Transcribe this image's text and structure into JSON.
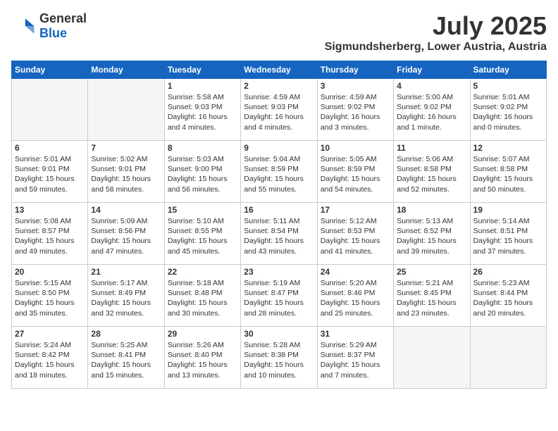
{
  "header": {
    "logo_general": "General",
    "logo_blue": "Blue",
    "month": "July 2025",
    "location": "Sigmundsherberg, Lower Austria, Austria"
  },
  "days_of_week": [
    "Sunday",
    "Monday",
    "Tuesday",
    "Wednesday",
    "Thursday",
    "Friday",
    "Saturday"
  ],
  "weeks": [
    [
      {
        "day": "",
        "empty": true
      },
      {
        "day": "",
        "empty": true
      },
      {
        "day": "1",
        "sunrise": "5:58 AM",
        "sunset": "9:03 PM",
        "daylight": "16 hours and 4 minutes."
      },
      {
        "day": "2",
        "sunrise": "4:59 AM",
        "sunset": "9:03 PM",
        "daylight": "16 hours and 4 minutes."
      },
      {
        "day": "3",
        "sunrise": "4:59 AM",
        "sunset": "9:02 PM",
        "daylight": "16 hours and 3 minutes."
      },
      {
        "day": "4",
        "sunrise": "5:00 AM",
        "sunset": "9:02 PM",
        "daylight": "16 hours and 1 minute."
      },
      {
        "day": "5",
        "sunrise": "5:01 AM",
        "sunset": "9:02 PM",
        "daylight": "16 hours and 0 minutes."
      }
    ],
    [
      {
        "day": "6",
        "sunrise": "5:01 AM",
        "sunset": "9:01 PM",
        "daylight": "15 hours and 59 minutes."
      },
      {
        "day": "7",
        "sunrise": "5:02 AM",
        "sunset": "9:01 PM",
        "daylight": "15 hours and 58 minutes."
      },
      {
        "day": "8",
        "sunrise": "5:03 AM",
        "sunset": "9:00 PM",
        "daylight": "15 hours and 56 minutes."
      },
      {
        "day": "9",
        "sunrise": "5:04 AM",
        "sunset": "8:59 PM",
        "daylight": "15 hours and 55 minutes."
      },
      {
        "day": "10",
        "sunrise": "5:05 AM",
        "sunset": "8:59 PM",
        "daylight": "15 hours and 54 minutes."
      },
      {
        "day": "11",
        "sunrise": "5:06 AM",
        "sunset": "8:58 PM",
        "daylight": "15 hours and 52 minutes."
      },
      {
        "day": "12",
        "sunrise": "5:07 AM",
        "sunset": "8:58 PM",
        "daylight": "15 hours and 50 minutes."
      }
    ],
    [
      {
        "day": "13",
        "sunrise": "5:08 AM",
        "sunset": "8:57 PM",
        "daylight": "15 hours and 49 minutes."
      },
      {
        "day": "14",
        "sunrise": "5:09 AM",
        "sunset": "8:56 PM",
        "daylight": "15 hours and 47 minutes."
      },
      {
        "day": "15",
        "sunrise": "5:10 AM",
        "sunset": "8:55 PM",
        "daylight": "15 hours and 45 minutes."
      },
      {
        "day": "16",
        "sunrise": "5:11 AM",
        "sunset": "8:54 PM",
        "daylight": "15 hours and 43 minutes."
      },
      {
        "day": "17",
        "sunrise": "5:12 AM",
        "sunset": "8:53 PM",
        "daylight": "15 hours and 41 minutes."
      },
      {
        "day": "18",
        "sunrise": "5:13 AM",
        "sunset": "8:52 PM",
        "daylight": "15 hours and 39 minutes."
      },
      {
        "day": "19",
        "sunrise": "5:14 AM",
        "sunset": "8:51 PM",
        "daylight": "15 hours and 37 minutes."
      }
    ],
    [
      {
        "day": "20",
        "sunrise": "5:15 AM",
        "sunset": "8:50 PM",
        "daylight": "15 hours and 35 minutes."
      },
      {
        "day": "21",
        "sunrise": "5:17 AM",
        "sunset": "8:49 PM",
        "daylight": "15 hours and 32 minutes."
      },
      {
        "day": "22",
        "sunrise": "5:18 AM",
        "sunset": "8:48 PM",
        "daylight": "15 hours and 30 minutes."
      },
      {
        "day": "23",
        "sunrise": "5:19 AM",
        "sunset": "8:47 PM",
        "daylight": "15 hours and 28 minutes."
      },
      {
        "day": "24",
        "sunrise": "5:20 AM",
        "sunset": "8:46 PM",
        "daylight": "15 hours and 25 minutes."
      },
      {
        "day": "25",
        "sunrise": "5:21 AM",
        "sunset": "8:45 PM",
        "daylight": "15 hours and 23 minutes."
      },
      {
        "day": "26",
        "sunrise": "5:23 AM",
        "sunset": "8:44 PM",
        "daylight": "15 hours and 20 minutes."
      }
    ],
    [
      {
        "day": "27",
        "sunrise": "5:24 AM",
        "sunset": "8:42 PM",
        "daylight": "15 hours and 18 minutes."
      },
      {
        "day": "28",
        "sunrise": "5:25 AM",
        "sunset": "8:41 PM",
        "daylight": "15 hours and 15 minutes."
      },
      {
        "day": "29",
        "sunrise": "5:26 AM",
        "sunset": "8:40 PM",
        "daylight": "15 hours and 13 minutes."
      },
      {
        "day": "30",
        "sunrise": "5:28 AM",
        "sunset": "8:38 PM",
        "daylight": "15 hours and 10 minutes."
      },
      {
        "day": "31",
        "sunrise": "5:29 AM",
        "sunset": "8:37 PM",
        "daylight": "15 hours and 7 minutes."
      },
      {
        "day": "",
        "empty": true
      },
      {
        "day": "",
        "empty": true
      }
    ]
  ]
}
